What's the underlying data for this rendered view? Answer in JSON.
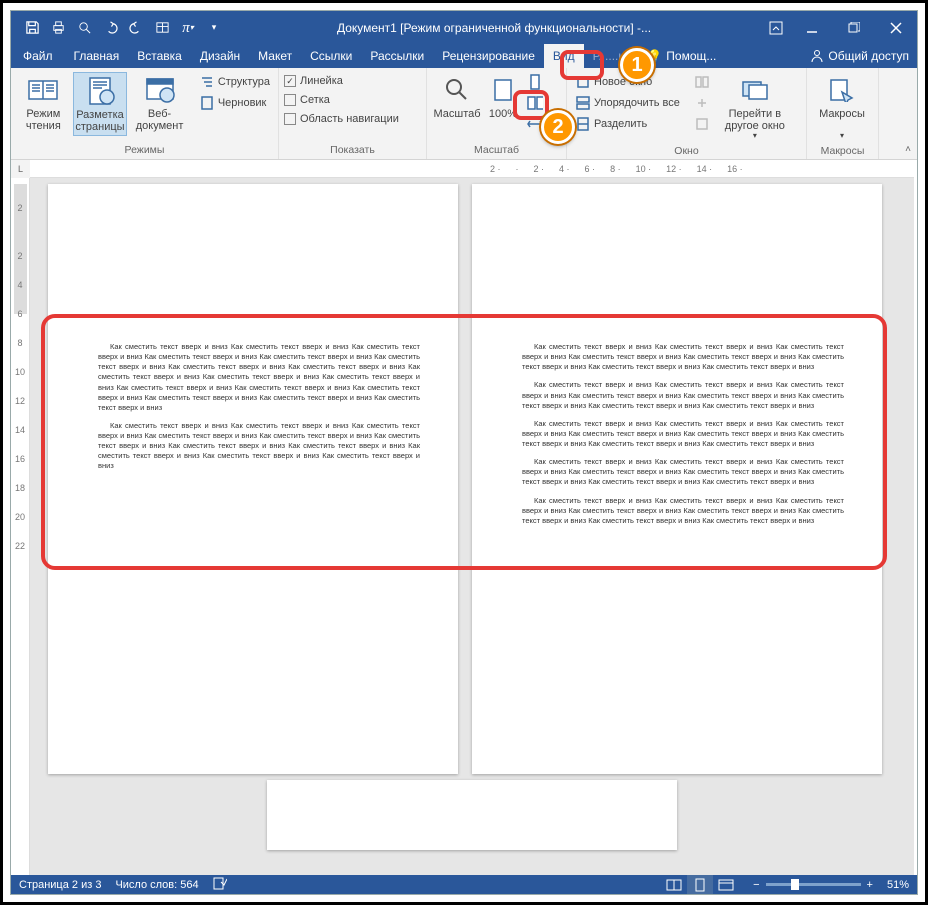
{
  "title": "Документ1 [Режим ограниченной функциональности] -...",
  "tabs": {
    "file": "Файл",
    "home": "Главная",
    "insert": "Вставка",
    "design": "Дизайн",
    "layout": "Макет",
    "references": "Ссылки",
    "mailings": "Рассылки",
    "review": "Рецензирование",
    "view": "Вид",
    "hidden": "Р......ик",
    "help": "Помощ...",
    "share": "Общий доступ"
  },
  "ribbon": {
    "modes": {
      "read": "Режим чтения",
      "print": "Разметка страницы",
      "web": "Веб-документ",
      "outline": "Структура",
      "draft": "Черновик",
      "label": "Режимы"
    },
    "show": {
      "ruler": "Линейка",
      "gridlines": "Сетка",
      "navpane": "Область навигации",
      "label": "Показать"
    },
    "zoom": {
      "zoom": "Масштаб",
      "hundred": "100%",
      "label": "Масштаб"
    },
    "window": {
      "newwin": "Новое окно",
      "arrange": "Упорядочить все",
      "split": "Разделить",
      "switch": "Перейти в другое окно",
      "label": "Окно"
    },
    "macros": {
      "macros": "Макросы",
      "label": "Макросы"
    }
  },
  "callouts": {
    "one": "1",
    "two": "2"
  },
  "ruler_corner": "L",
  "ruler_h": [
    "2",
    "",
    "2",
    "4",
    "6",
    "8",
    "10",
    "12",
    "14",
    "16"
  ],
  "ruler_v": [
    "",
    "2",
    "",
    "2",
    "4",
    "6",
    "8",
    "10",
    "12",
    "14",
    "16",
    "18",
    "20",
    "22"
  ],
  "doc_text": {
    "base": "Как сместить текст вверх и вниз Как сместить текст вверх и вниз Как сместить текст вверх и вниз Как сместить текст вверх и вниз Как сместить текст вверх и вниз Как сместить текст вверх и вниз Как сместить текст вверх и вниз Как сместить текст вверх и вниз Как сместить текст вверх и вниз Как сместить текст вверх и вниз Как сместить текст вверх и вниз Как сместить текст вверх и вниз Как сместить текст вверх и вниз Как сместить текст вверх и вниз Как сместить текст вверх и вниз Как сместить текст вверх и вниз Как сместить текст вверх и вниз",
    "short": "Как сместить текст вверх и вниз Как сместить текст вверх и вниз Как сместить текст вверх и вниз Как сместить текст вверх и вниз Как сместить текст вверх и вниз Как сместить текст вверх и вниз Как сместить текст вверх и вниз Как сместить текст вверх и вниз Как сместить текст вверх и вниз Как сместить текст вверх и вниз Как сместить текст вверх и вниз",
    "mini": "Как сместить текст вверх и вниз Как сместить текст вверх и вниз Как сместить текст вверх и вниз Как сместить текст вверх и вниз Как сместить текст вверх и вниз Как сместить текст вверх и вниз Как сместить текст вверх и вниз Как сместить текст вверх и вниз"
  },
  "status": {
    "page": "Страница 2 из 3",
    "words": "Число слов: 564",
    "zoom": "51%",
    "minus": "−",
    "plus": "+"
  }
}
